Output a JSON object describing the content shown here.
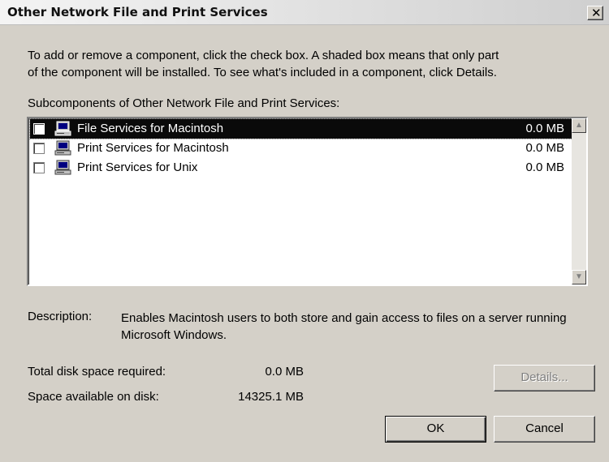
{
  "window": {
    "title": "Other Network File and Print Services",
    "close_glyph": "✕"
  },
  "intro": {
    "line1": "To add or remove a component, click the check box. A shaded box means that only part",
    "line2": "of the component will be installed. To see what's included in a component, click Details."
  },
  "subcomponents_label": "Subcomponents of Other Network File and Print Services:",
  "components": [
    {
      "label": "File Services for Macintosh",
      "size": "0.0 MB",
      "checked": false,
      "selected": true,
      "icon": "network-computer-icon"
    },
    {
      "label": "Print Services for Macintosh",
      "size": "0.0 MB",
      "checked": false,
      "selected": false,
      "icon": "network-computer-icon"
    },
    {
      "label": "Print Services for Unix",
      "size": "0.0 MB",
      "checked": false,
      "selected": false,
      "icon": "network-computer-icon"
    }
  ],
  "description": {
    "label": "Description:",
    "text": "Enables Macintosh users to both store and gain access to files on a server running Microsoft Windows."
  },
  "disk": {
    "required_label": "Total disk space required:",
    "required_value": "0.0 MB",
    "available_label": "Space available on disk:",
    "available_value": "14325.1 MB"
  },
  "buttons": {
    "details": "Details...",
    "ok": "OK",
    "cancel": "Cancel"
  },
  "colors": {
    "face": "#d4d0c8",
    "selection": "#0a0a0a"
  }
}
